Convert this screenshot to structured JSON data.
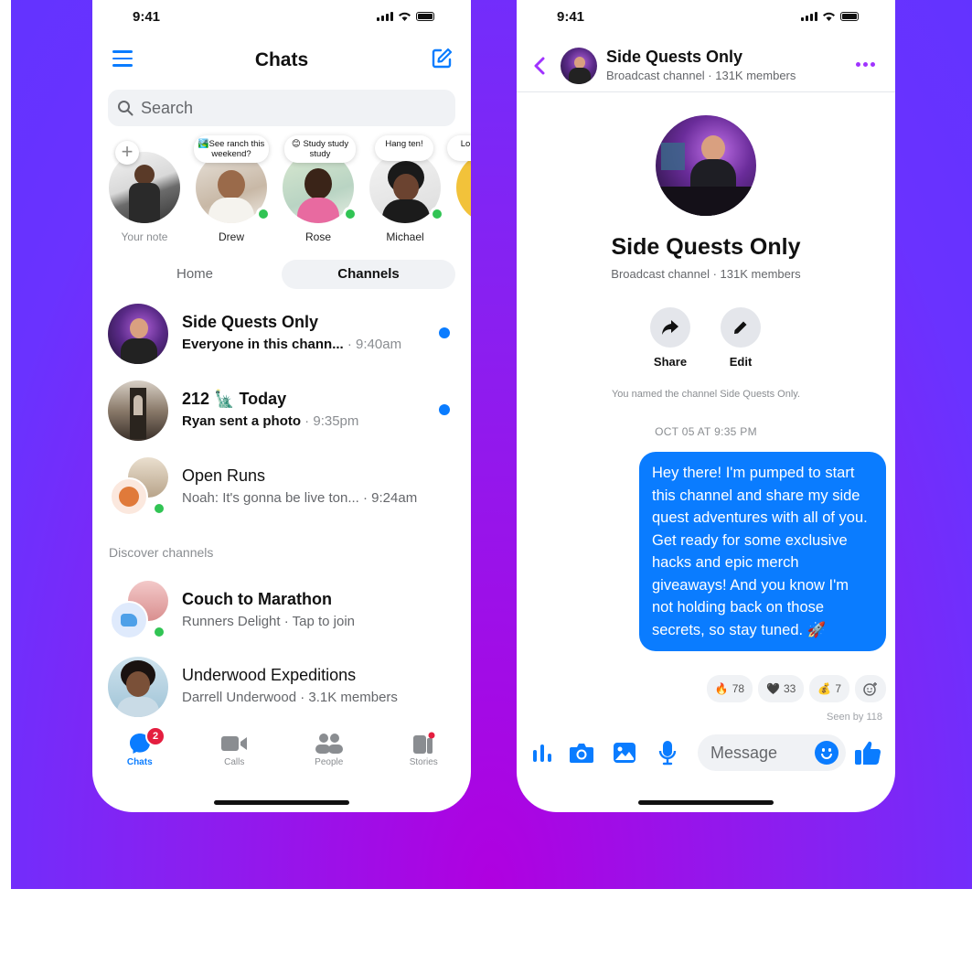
{
  "left_phone": {
    "status_time": "9:41",
    "title": "Chats",
    "search_placeholder": "Search",
    "notes": [
      {
        "name": "Your note",
        "bubble": "",
        "online": false
      },
      {
        "name": "Drew",
        "bubble": "🏞️See ranch this weekend?",
        "online": true
      },
      {
        "name": "Rose",
        "bubble": "😊 Study study study",
        "online": true
      },
      {
        "name": "Michael",
        "bubble": "Hang ten!",
        "online": true
      },
      {
        "name": "",
        "bubble": "Lo",
        "online": false
      }
    ],
    "segments": {
      "home": "Home",
      "channels": "Channels"
    },
    "chats": [
      {
        "title": "Side Quests Only",
        "preview": "Everyone in this chann...",
        "time": " · 9:40am",
        "unread": true
      },
      {
        "title": "212 🗽 Today",
        "preview": "Ryan sent a photo",
        "time": " · 9:35pm",
        "unread": true
      },
      {
        "title": "Open Runs",
        "preview": "Noah: It's gonna be live ton...",
        "time": " · 9:24am",
        "unread": false
      }
    ],
    "section_label": "Discover channels",
    "discover": [
      {
        "title": "Couch to Marathon",
        "subtitle": "Runners Delight · Tap to join"
      },
      {
        "title": "Underwood Expeditions",
        "subtitle": "Darrell Underwood · 3.1K members"
      }
    ],
    "tabs": {
      "chats": "Chats",
      "calls": "Calls",
      "people": "People",
      "stories": "Stories",
      "chats_badge": "2"
    }
  },
  "right_phone": {
    "status_time": "9:41",
    "header_title": "Side Quests Only",
    "header_subtitle": "Broadcast channel · 131K members",
    "channel_title": "Side Quests Only",
    "channel_subtitle": "Broadcast channel · 131K members",
    "actions": {
      "share": "Share",
      "edit": "Edit"
    },
    "system_message": "You named the channel Side Quests Only.",
    "date_label": "OCT 05 AT 9:35 PM",
    "message": "Hey there! I'm pumped to start this channel and share my side quest adventures with all of you. Get ready for some exclusive hacks and epic merch giveaways! And you know I'm not holding back on those secrets, so stay tuned. 🚀",
    "reactions": [
      {
        "emoji": "🔥",
        "count": "78"
      },
      {
        "emoji": "🖤",
        "count": "33"
      },
      {
        "emoji": "💰",
        "count": "7"
      }
    ],
    "seen_by": "Seen by 118",
    "input_placeholder": "Message"
  },
  "colors": {
    "accent": "#0a7cff",
    "purple": "#a033ff",
    "online": "#31c454",
    "badge": "#e41e3f"
  }
}
